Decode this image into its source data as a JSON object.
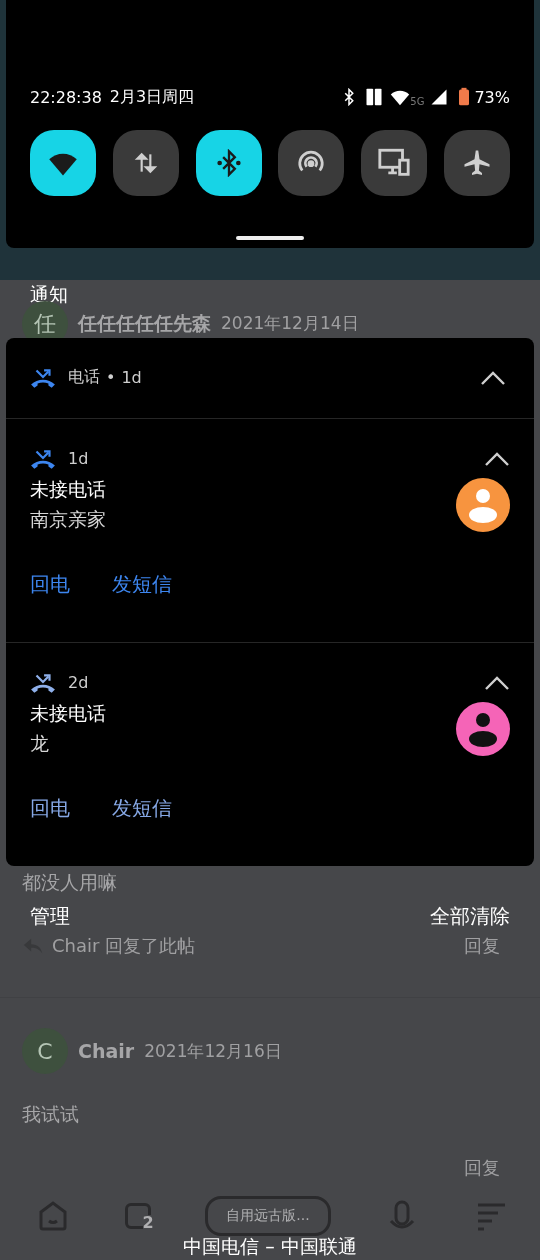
{
  "status_bar": {
    "time": "22:28:38",
    "date": "2月3日周四",
    "network": "5G",
    "battery": "73%"
  },
  "quick_settings": [
    {
      "kind": "wifi",
      "on": true
    },
    {
      "kind": "data",
      "on": false
    },
    {
      "kind": "bluetooth",
      "on": true
    },
    {
      "kind": "hotspot",
      "on": false
    },
    {
      "kind": "cast",
      "on": false
    },
    {
      "kind": "airplane",
      "on": false
    }
  ],
  "shade_title": "通知",
  "background_post_1": {
    "author": "任任任任任先森",
    "date": "2021年12月14日",
    "avatar_letter": "任"
  },
  "notification_group": {
    "app": "电话",
    "separator": "•",
    "time": "1d",
    "expanded": true,
    "notifications": [
      {
        "time": "1d",
        "title": "未接电话",
        "caller": "南京亲家",
        "color": "#f7943f",
        "expanded": true,
        "actions": [
          "回电",
          "发短信"
        ]
      },
      {
        "time": "2d",
        "title": "未接电话",
        "caller": "龙",
        "color": "#f564b7",
        "expanded": true,
        "actions": [
          "回电",
          "发短信"
        ]
      }
    ]
  },
  "background_text_1": "都没人用嘛",
  "shade_actions": {
    "manage": "管理",
    "clear_all": "全部清除"
  },
  "background_reply": {
    "text": "Chair 回复了此帖",
    "reply": "回复"
  },
  "background_post_2": {
    "author": "Chair",
    "date": "2021年12月16日",
    "avatar_letter": "C",
    "body": "我试试",
    "reply": "回复"
  },
  "bottom_nav": {
    "tab_count": "2",
    "title": "自用远古版..."
  },
  "carrier": "中国电信 – 中国联通"
}
